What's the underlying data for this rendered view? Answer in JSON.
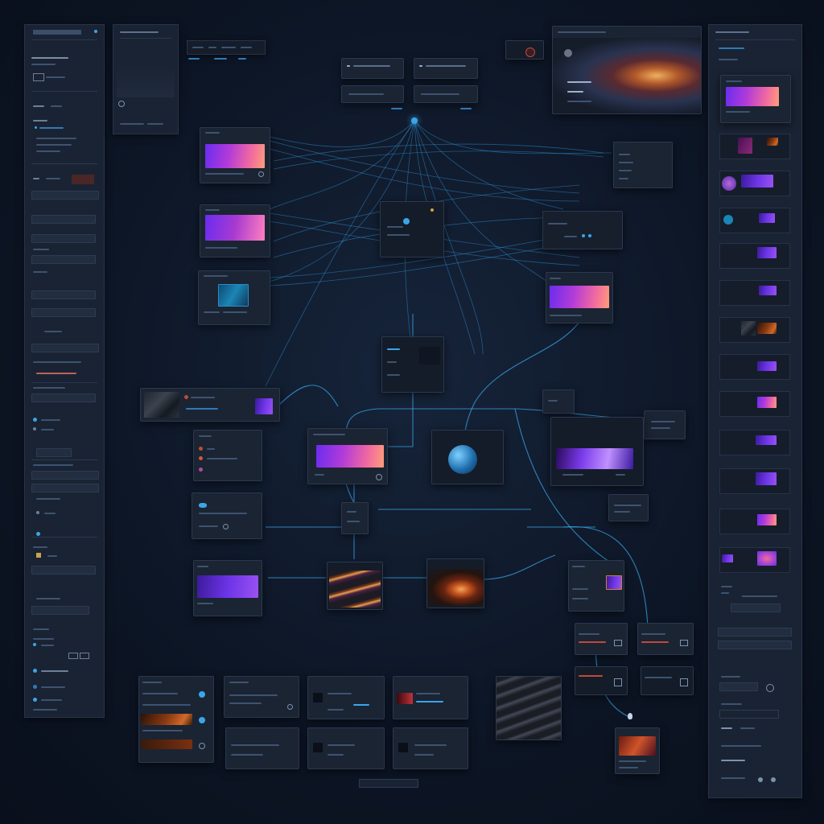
{
  "colors": {
    "accent": "#3aa6e8",
    "bg": "#0d1626",
    "panel": "#1a2333",
    "pink": "#f06aa0",
    "violet": "#6c34e6"
  },
  "left_panel": {
    "title": "",
    "items": [
      "",
      "",
      "",
      "",
      "",
      "",
      "",
      "",
      "",
      "",
      "",
      "",
      ""
    ]
  },
  "right_panel": {
    "title": ""
  },
  "icons": {
    "globe": "globe-icon",
    "node": "node-icon",
    "refresh": "refresh-icon",
    "play": "play-icon",
    "pin": "pin-icon"
  }
}
